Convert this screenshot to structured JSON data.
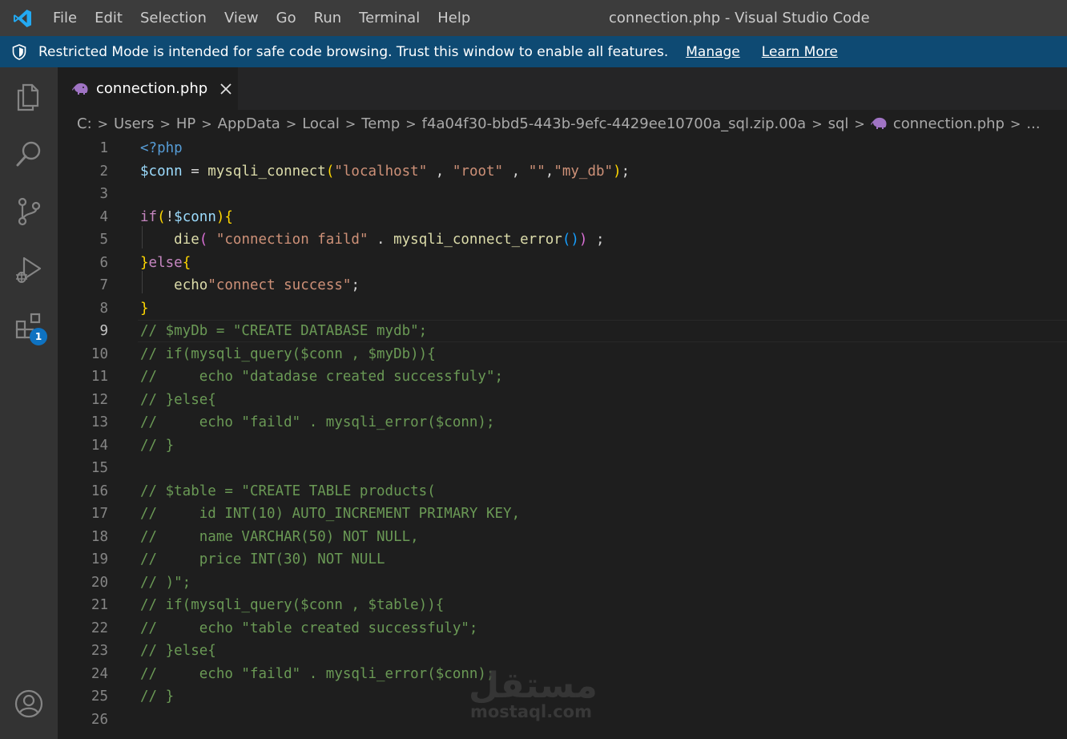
{
  "titlebar": {
    "menu": [
      "File",
      "Edit",
      "Selection",
      "View",
      "Go",
      "Run",
      "Terminal",
      "Help"
    ],
    "window_title": "connection.php - Visual Studio Code"
  },
  "restricted": {
    "message": "Restricted Mode is intended for safe code browsing. Trust this window to enable all features.",
    "manage": "Manage",
    "learn_more": "Learn More"
  },
  "activity": {
    "extensions_badge": "1"
  },
  "tab": {
    "label": "connection.php"
  },
  "breadcrumb": [
    "C:",
    "Users",
    "HP",
    "AppData",
    "Local",
    "Temp",
    "f4a04f30-bbd5-443b-9efc-4429ee10700a_sql.zip.00a",
    "sql",
    "connection.php",
    "..."
  ],
  "editor": {
    "active_line": 9,
    "lines": [
      {
        "n": "1",
        "t": [
          [
            "<?php",
            "tag"
          ]
        ]
      },
      {
        "n": "2",
        "t": [
          [
            "$conn",
            "var"
          ],
          [
            " = ",
            "op"
          ],
          [
            "mysqli_connect",
            "fn"
          ],
          [
            "(",
            "br1"
          ],
          [
            "\"localhost\"",
            "str"
          ],
          [
            " , ",
            "op"
          ],
          [
            "\"root\"",
            "str"
          ],
          [
            " , ",
            "op"
          ],
          [
            "\"\"",
            "str"
          ],
          [
            ",",
            "op"
          ],
          [
            "\"my_db\"",
            "str"
          ],
          [
            ")",
            "br1"
          ],
          [
            ";",
            "op"
          ]
        ]
      },
      {
        "n": "3",
        "t": []
      },
      {
        "n": "4",
        "t": [
          [
            "if",
            "kw"
          ],
          [
            "(",
            "br1"
          ],
          [
            "!",
            "op"
          ],
          [
            "$conn",
            "var"
          ],
          [
            ")",
            "br1"
          ],
          [
            "{",
            "br1"
          ]
        ]
      },
      {
        "n": "5",
        "t": [
          [
            "    ",
            "op"
          ],
          [
            "die",
            "fn"
          ],
          [
            "( ",
            "br2"
          ],
          [
            "\"connection faild\"",
            "str"
          ],
          [
            " . ",
            "op"
          ],
          [
            "mysqli_connect_error",
            "fn"
          ],
          [
            "()",
            "br3"
          ],
          [
            ")",
            "br2"
          ],
          [
            " ;",
            "op"
          ]
        ]
      },
      {
        "n": "6",
        "t": [
          [
            "}",
            "br1"
          ],
          [
            "else",
            "kw"
          ],
          [
            "{",
            "br1"
          ]
        ]
      },
      {
        "n": "7",
        "t": [
          [
            "    ",
            "op"
          ],
          [
            "echo",
            "fn"
          ],
          [
            "\"connect success\"",
            "str"
          ],
          [
            ";",
            "op"
          ]
        ]
      },
      {
        "n": "8",
        "t": [
          [
            "}",
            "br1"
          ]
        ]
      },
      {
        "n": "9",
        "t": [
          [
            "// $myDb = \"CREATE DATABASE mydb\";",
            "com"
          ]
        ]
      },
      {
        "n": "10",
        "t": [
          [
            "// if(mysqli_query($conn , $myDb)){",
            "com"
          ]
        ]
      },
      {
        "n": "11",
        "t": [
          [
            "//     echo \"datadase created successfuly\";",
            "com"
          ]
        ]
      },
      {
        "n": "12",
        "t": [
          [
            "// }else{",
            "com"
          ]
        ]
      },
      {
        "n": "13",
        "t": [
          [
            "//     echo \"faild\" . mysqli_error($conn);",
            "com"
          ]
        ]
      },
      {
        "n": "14",
        "t": [
          [
            "// }",
            "com"
          ]
        ]
      },
      {
        "n": "15",
        "t": []
      },
      {
        "n": "16",
        "t": [
          [
            "// $table = \"CREATE TABLE products(",
            "com"
          ]
        ]
      },
      {
        "n": "17",
        "t": [
          [
            "//     id INT(10) AUTO_INCREMENT PRIMARY KEY,",
            "com"
          ]
        ]
      },
      {
        "n": "18",
        "t": [
          [
            "//     name VARCHAR(50) NOT NULL,",
            "com"
          ]
        ]
      },
      {
        "n": "19",
        "t": [
          [
            "//     price INT(30) NOT NULL",
            "com"
          ]
        ]
      },
      {
        "n": "20",
        "t": [
          [
            "// )\";",
            "com"
          ]
        ]
      },
      {
        "n": "21",
        "t": [
          [
            "// if(mysqli_query($conn , $table)){",
            "com"
          ]
        ]
      },
      {
        "n": "22",
        "t": [
          [
            "//     echo \"table created successfuly\";",
            "com"
          ]
        ]
      },
      {
        "n": "23",
        "t": [
          [
            "// }else{",
            "com"
          ]
        ]
      },
      {
        "n": "24",
        "t": [
          [
            "//     echo \"faild\" . mysqli_error($conn);",
            "com"
          ]
        ]
      },
      {
        "n": "25",
        "t": [
          [
            "// }",
            "com"
          ]
        ]
      },
      {
        "n": "26",
        "t": []
      }
    ]
  },
  "watermark": {
    "arabic": "مستقل",
    "latin": "mostaql.com"
  }
}
